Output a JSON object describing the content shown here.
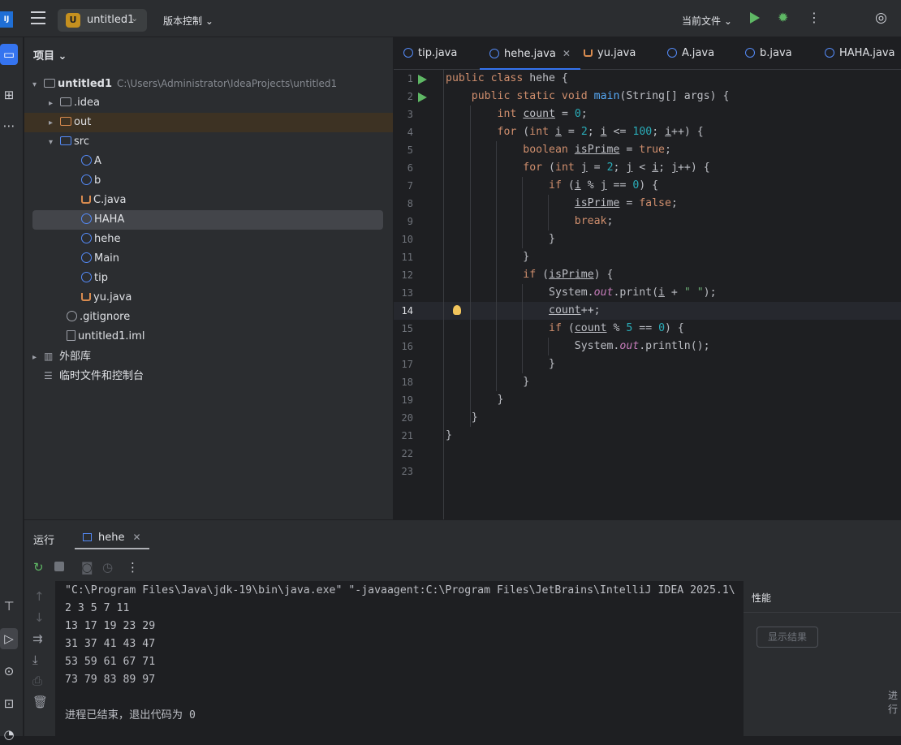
{
  "titlebar": {
    "logo": "IJ",
    "project_badge": "U",
    "project_name": "untitled1",
    "vcs_label": "版本控制",
    "current_file_label": "当前文件"
  },
  "project_panel": {
    "title": "项目",
    "tree": [
      {
        "label": "untitled1",
        "path": "C:\\Users\\Administrator\\IdeaProjects\\untitled1"
      },
      {
        "label": ".idea"
      },
      {
        "label": "out"
      },
      {
        "label": "src"
      },
      {
        "label": "A"
      },
      {
        "label": "b"
      },
      {
        "label": "C.java"
      },
      {
        "label": "HAHA"
      },
      {
        "label": "hehe"
      },
      {
        "label": "Main"
      },
      {
        "label": "tip"
      },
      {
        "label": "yu.java"
      },
      {
        "label": ".gitignore"
      },
      {
        "label": "untitled1.iml"
      },
      {
        "label": "外部库"
      },
      {
        "label": "临时文件和控制台"
      }
    ]
  },
  "editor": {
    "tabs": [
      "tip.java",
      "hehe.java",
      "yu.java",
      "A.java",
      "b.java",
      "HAHA.java"
    ],
    "active_tab": "hehe.java",
    "current_line": 14,
    "line_numbers": [
      "1",
      "2",
      "3",
      "4",
      "5",
      "6",
      "7",
      "8",
      "9",
      "10",
      "11",
      "12",
      "13",
      "14",
      "15",
      "16",
      "17",
      "18",
      "19",
      "20",
      "21",
      "22",
      "23"
    ]
  },
  "run_panel": {
    "title": "运行",
    "tab_label": "hehe",
    "console_lines": [
      "\"C:\\Program Files\\Java\\jdk-19\\bin\\java.exe\" \"-javaagent:C:\\Program Files\\JetBrains\\IntelliJ IDEA 2025.1\\",
      "2 3 5 7 11",
      "13 17 19 23 29",
      "31 37 41 43 47",
      "53 59 61 67 71",
      "73 79 83 89 97",
      "",
      "进程已结束，退出代码为 0"
    ],
    "perf_title": "性能",
    "perf_button": "显示结果",
    "perf_more": "进行"
  }
}
